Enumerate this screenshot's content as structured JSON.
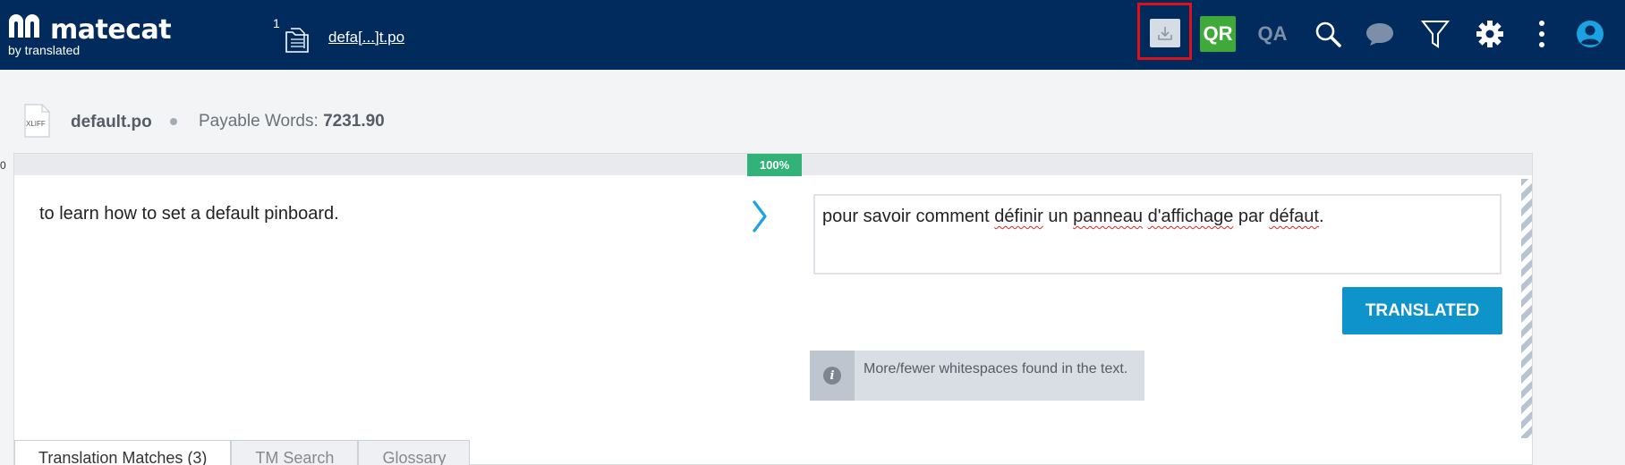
{
  "brand": {
    "name": "matecat",
    "sub": "by translated"
  },
  "header": {
    "file_count": "1",
    "file_link": "defa[...]t.po",
    "qr_label": "QR",
    "qa_label": "QA"
  },
  "file_info": {
    "filename": "default.po",
    "payable_label": "Payable Words:",
    "payable_value": "7231.90",
    "file_type": "XLIFF"
  },
  "left_edge_char": "0",
  "segment": {
    "match_percent": "100%",
    "source": "to learn how to set a default pinboard.",
    "target_parts": [
      {
        "text": "pour savoir comment ",
        "spell": false
      },
      {
        "text": "définir",
        "spell": true
      },
      {
        "text": " un ",
        "spell": false
      },
      {
        "text": "panneau",
        "spell": true
      },
      {
        "text": " ",
        "spell": false
      },
      {
        "text": "d'affichage",
        "spell": true
      },
      {
        "text": " par ",
        "spell": false
      },
      {
        "text": "défaut",
        "spell": true
      },
      {
        "text": ".",
        "spell": false
      }
    ],
    "status_button": "TRANSLATED",
    "warning": "More/fewer whitespaces found in the text."
  },
  "tabs": [
    {
      "label": "Translation Matches (3)",
      "active": true
    },
    {
      "label": "TM Search",
      "active": false
    },
    {
      "label": "Glossary",
      "active": false
    }
  ],
  "colors": {
    "header_bg": "#002b5c",
    "qr_bg": "#3fa93a",
    "match_green": "#31b276",
    "accent_blue": "#0f93cb",
    "highlight_red": "#e0101a"
  },
  "icons": [
    "download-icon",
    "search-icon",
    "comment-icon",
    "filter-icon",
    "gear-icon",
    "more-vertical-icon",
    "user-icon",
    "folder-files-icon",
    "xliff-file-icon",
    "chevron-right-icon",
    "info-icon"
  ]
}
